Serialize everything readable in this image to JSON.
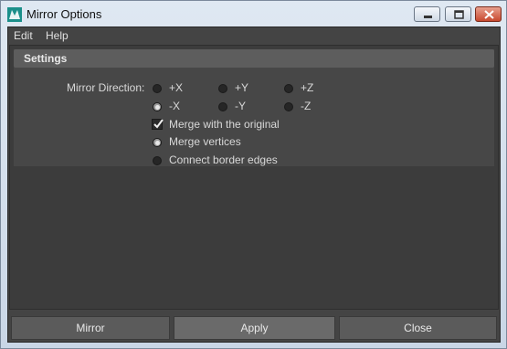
{
  "window": {
    "title": "Mirror Options"
  },
  "menu": [
    "Edit",
    "Help"
  ],
  "settings": {
    "header": "Settings",
    "mirror_direction_label": "Mirror Direction:",
    "directions": [
      {
        "label": "+X",
        "selected": false
      },
      {
        "label": "+Y",
        "selected": false
      },
      {
        "label": "+Z",
        "selected": false
      },
      {
        "label": "-X",
        "selected": true
      },
      {
        "label": "-Y",
        "selected": false
      },
      {
        "label": "-Z",
        "selected": false
      }
    ],
    "merge_with_original": {
      "label": "Merge with the original",
      "checked": true
    },
    "merge_options": [
      {
        "label": "Merge vertices",
        "selected": true
      },
      {
        "label": "Connect border edges",
        "selected": false
      }
    ]
  },
  "buttons": {
    "mirror": "Mirror",
    "apply": "Apply",
    "close": "Close"
  },
  "colors": {
    "panel": "#444444",
    "frame_header": "#5d5d5d",
    "text": "#d8d8d8"
  }
}
